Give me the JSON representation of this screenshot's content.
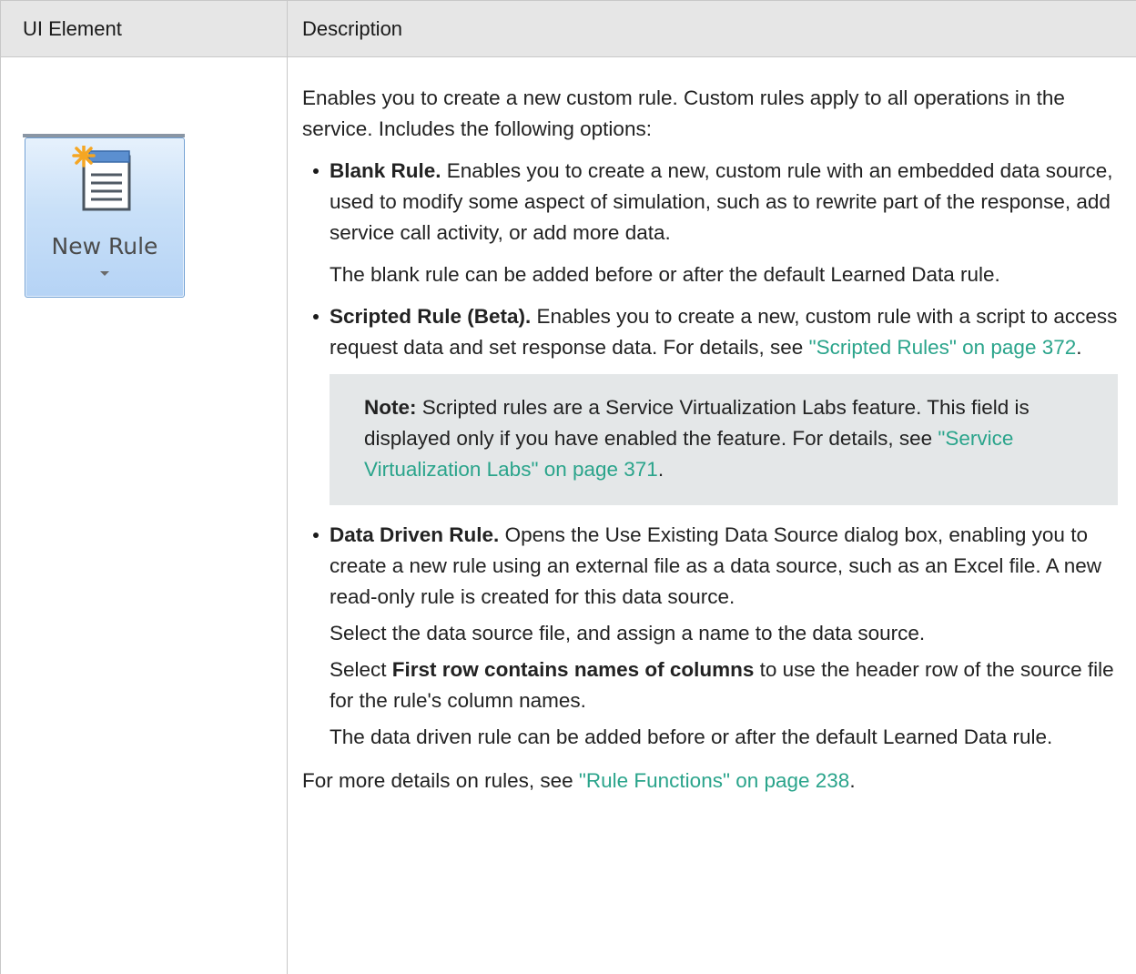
{
  "table": {
    "headers": {
      "ui_element": "UI Element",
      "description": "Description"
    }
  },
  "ui_element": {
    "button_label": "New Rule",
    "icon": "new-document-icon",
    "colors": {
      "button_border": "#6f9fd3",
      "button_fill": "#c9e0f8",
      "star": "#f5a623"
    }
  },
  "description": {
    "intro": "Enables you to create a new custom rule. Custom rules apply to all operations in the service. Includes the following options:",
    "blank_rule": {
      "title": "Blank Rule.",
      "text": " Enables you to create a new, custom rule with an embedded data source, used to modify some aspect of simulation, such as to rewrite part of the response, add service call activity, or add more data.",
      "extra": "The blank rule can be added before or after the default Learned Data rule."
    },
    "scripted_rule": {
      "title": "Scripted Rule (Beta).",
      "text": " Enables you to create a new, custom rule with a script to access request data and set response data. For details, see ",
      "link": "\"Scripted Rules\" on page 372",
      "end": "."
    },
    "note": {
      "label": "Note:",
      "text": " Scripted rules are a Service Virtualization Labs feature. This field is displayed only if you have enabled the feature. For details, see ",
      "link": "\"Service Virtualization Labs\" on page 371",
      "end": "."
    },
    "data_driven_rule": {
      "title": "Data Driven Rule.",
      "text": " Opens the Use Existing Data Source dialog box, enabling you to create a new rule using an external file as a data source, such as an Excel file. A new read-only rule is created for this data source.",
      "select_file": "Select the data source file, and assign a name to the data source.",
      "select_prefix": "Select ",
      "select_bold": "First row contains names of columns",
      "select_suffix": " to use the header row of the source file for the rule's column names.",
      "extra": "The data driven rule can be added before or after the default Learned Data rule."
    },
    "footer": {
      "prefix": "For more details on rules, see ",
      "link": "\"Rule Functions\" on page 238",
      "end": "."
    },
    "colors": {
      "link": "#2aa48b",
      "note_bg": "#e4e7e8",
      "header_bg": "#e6e6e6"
    }
  }
}
